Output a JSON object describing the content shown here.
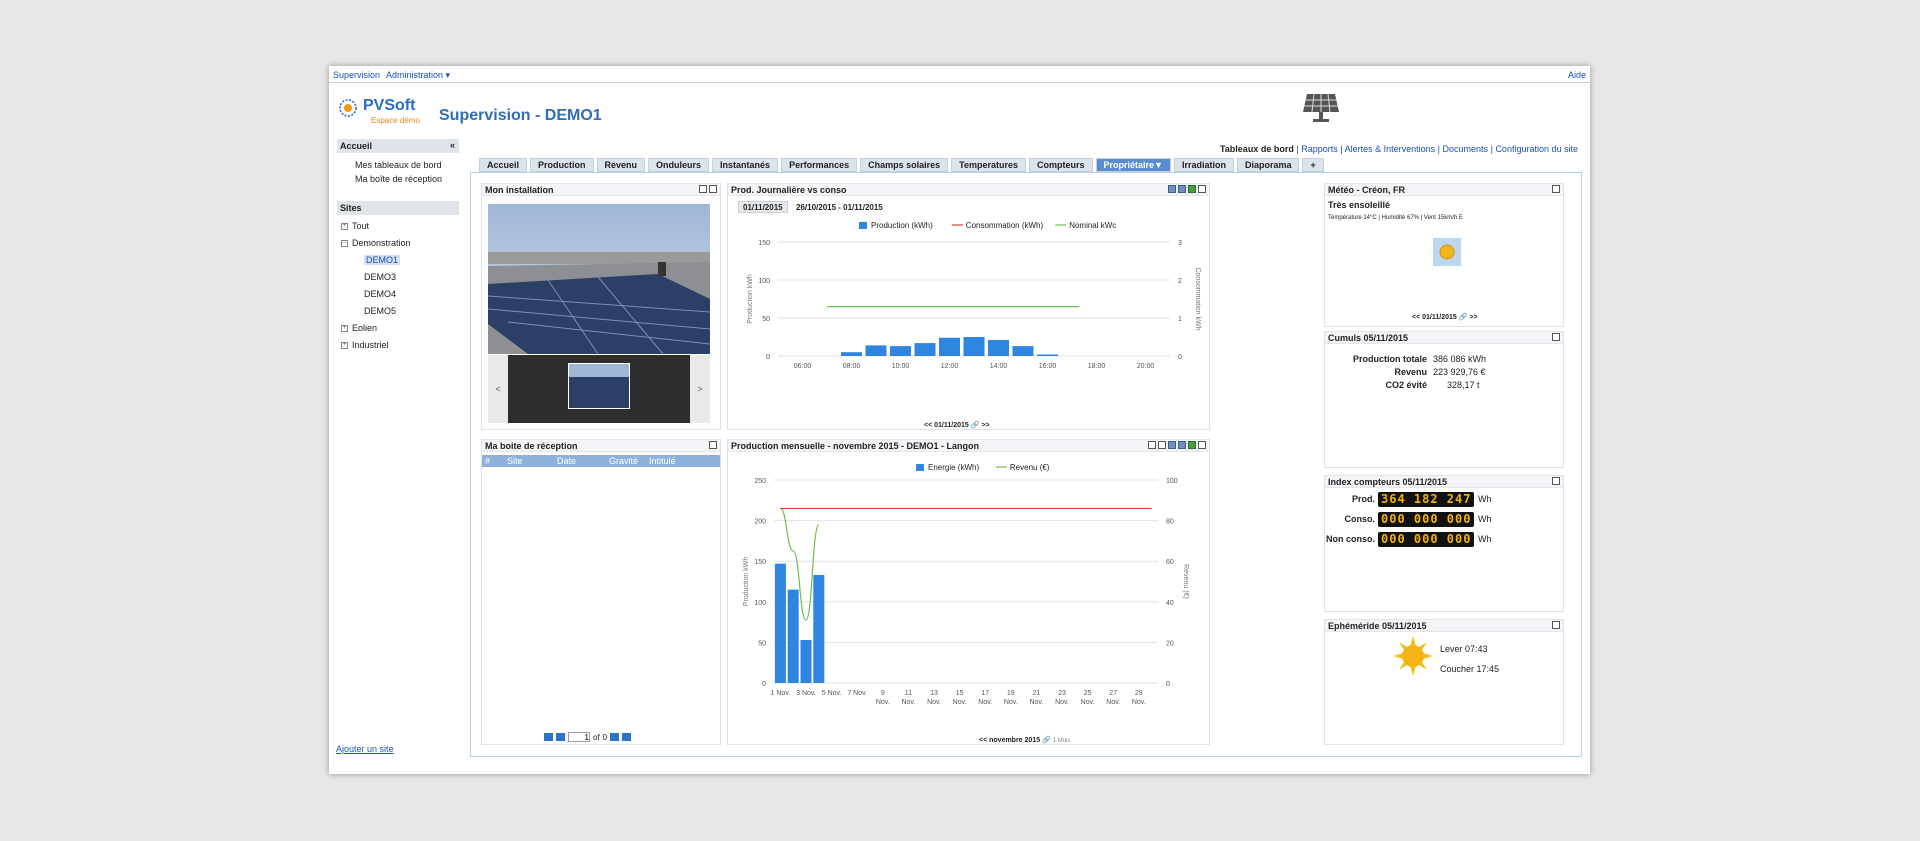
{
  "topnav": {
    "supervision": "Supervision",
    "administration": "Administration ▾",
    "aide": "Aide"
  },
  "logo": {
    "brand": "PVSoft",
    "sub": "Espace démo"
  },
  "page_title": "Supervision - DEMO1",
  "links": {
    "dashboard": "Tableaux de bord",
    "sep": "|",
    "rapports": "Rapports",
    "alertes": "Alertes & Interventions",
    "documents": "Documents",
    "config": "Configuration du site"
  },
  "sidebar": {
    "accueil_title": "Accueil",
    "collapse": "«",
    "accueil_items": [
      "Mes tableaux de bord",
      "Ma boîte de réception"
    ],
    "sites_title": "Sites",
    "tree": {
      "tout": "Tout",
      "demonstration": "Demonstration",
      "demos": [
        "DEMO1",
        "DEMO3",
        "DEMO4",
        "DEMO5"
      ],
      "eolien": "Eolien",
      "industriel": "Industriel"
    },
    "add_site": "Ajouter un site"
  },
  "tabs": [
    "Accueil",
    "Production",
    "Revenu",
    "Onduleurs",
    "Instantanés",
    "Performances",
    "Champs solaires",
    "Temperatures",
    "Compteurs",
    "Propriétaire▼",
    "Irradiation",
    "Diaporama",
    "+"
  ],
  "active_tab": "Propriétaire▼",
  "install": {
    "title": "Mon installation",
    "prev": "<",
    "next": ">"
  },
  "inbox": {
    "title": "Ma boite de réception",
    "cols": [
      "#",
      "Site",
      "Date",
      "Gravité",
      "Intitulé"
    ],
    "page": "1",
    "of": "of",
    "total": "0"
  },
  "daily": {
    "title": "Prod. Journalière vs conso",
    "date_tabs": [
      "01/11/2015",
      "26/10/2015 - 01/11/2015"
    ],
    "nav": "<< 01/11/2015 🔗 >>"
  },
  "monthly": {
    "title": "Production mensuelle - novembre 2015 - DEMO1 - Langon",
    "nav": "<< novembre 2015 🔗",
    "nav2": "1 Mois"
  },
  "meteo": {
    "title": "Météo - Créon, FR",
    "condition": "Très ensoleillé",
    "details": "Température 14°C | Humidité 67% | Vent 15km/h E",
    "nav": "<< 01/11/2015 🔗 >>"
  },
  "cumuls": {
    "title": "Cumuls 05/11/2015",
    "rows": [
      {
        "label": "Production totale",
        "value": "386 086 kWh"
      },
      {
        "label": "Revenu",
        "value": "223 929,76 €"
      },
      {
        "label": "CO2 évité",
        "value": "328,17 t"
      }
    ]
  },
  "index": {
    "title": "Index compteurs 05/11/2015",
    "rows": [
      {
        "label": "Prod.",
        "value": "364 182 247",
        "unit": "Wh"
      },
      {
        "label": "Conso.",
        "value": "000 000 000",
        "unit": "Wh"
      },
      {
        "label": "Non conso.",
        "value": "000 000 000",
        "unit": "Wh"
      }
    ]
  },
  "ephem": {
    "title": "Ephéméride 05/11/2015",
    "lever": "Lever 07:43",
    "coucher": "Coucher 17:45"
  },
  "colors": {
    "accent": "#2f6db5",
    "bar": "#2f86e0",
    "conso": "#d0452f",
    "nominal": "#6cbf4a"
  },
  "chart_data": [
    {
      "type": "bar",
      "title": "",
      "legend": [
        "Production (kWh)",
        "Consommation (kWh)",
        "Nominal kWc"
      ],
      "legend_position": "top",
      "xlabel": "",
      "ylabel": "Production kWh",
      "y2label": "Consommation kWh",
      "x_ticks": [
        "06:00",
        "08:00",
        "10:00",
        "12:00",
        "14:00",
        "16:00",
        "18:00",
        "20:00"
      ],
      "y_ticks": [
        0,
        50,
        100,
        150
      ],
      "y2_ticks": [
        0,
        1,
        2,
        3
      ],
      "ylim": [
        0,
        150
      ],
      "y2lim": [
        0,
        3
      ],
      "xlim": [
        5,
        21
      ],
      "series": [
        {
          "name": "Production (kWh)",
          "kind": "bar",
          "x": [
            8,
            9,
            10,
            11,
            12,
            13,
            14,
            15,
            16,
            17
          ],
          "values": [
            5,
            14,
            13,
            17,
            24,
            25,
            21,
            13,
            2,
            0
          ]
        },
        {
          "name": "Nominal kWc",
          "kind": "line",
          "x": [
            7,
            17.3
          ],
          "values": [
            65,
            65
          ]
        }
      ]
    },
    {
      "type": "bar",
      "title": "",
      "legend": [
        "Energie (kWh)",
        "Revenu (€)"
      ],
      "legend_position": "top",
      "ylabel": "Production kWh",
      "y2label": "Revenu (€)",
      "x_ticks": [
        "1 Nov.",
        "3 Nov.",
        "5 Nov.",
        "7 Nov.",
        "9 Nov.",
        "11 Nov.",
        "13 Nov.",
        "15 Nov.",
        "17 Nov.",
        "19 Nov.",
        "21 Nov.",
        "23 Nov.",
        "25 Nov.",
        "27 Nov.",
        "29 Nov."
      ],
      "y_ticks": [
        0,
        50,
        100,
        150,
        200,
        250
      ],
      "y2_ticks": [
        0,
        20,
        40,
        60,
        80,
        100
      ],
      "ylim": [
        0,
        250
      ],
      "y2lim": [
        0,
        100
      ],
      "xlim": [
        0.5,
        30.5
      ],
      "series": [
        {
          "name": "Energie (kWh)",
          "kind": "bar",
          "x": [
            1,
            2,
            3,
            4
          ],
          "values": [
            147,
            115,
            53,
            133
          ]
        },
        {
          "name": "Revenu (€)",
          "kind": "line",
          "x": [
            1,
            2,
            3,
            4
          ],
          "values": [
            86,
            65,
            31,
            78
          ]
        }
      ],
      "reference_line": {
        "value": 86,
        "x_from": 1,
        "x_to": 30
      }
    }
  ]
}
